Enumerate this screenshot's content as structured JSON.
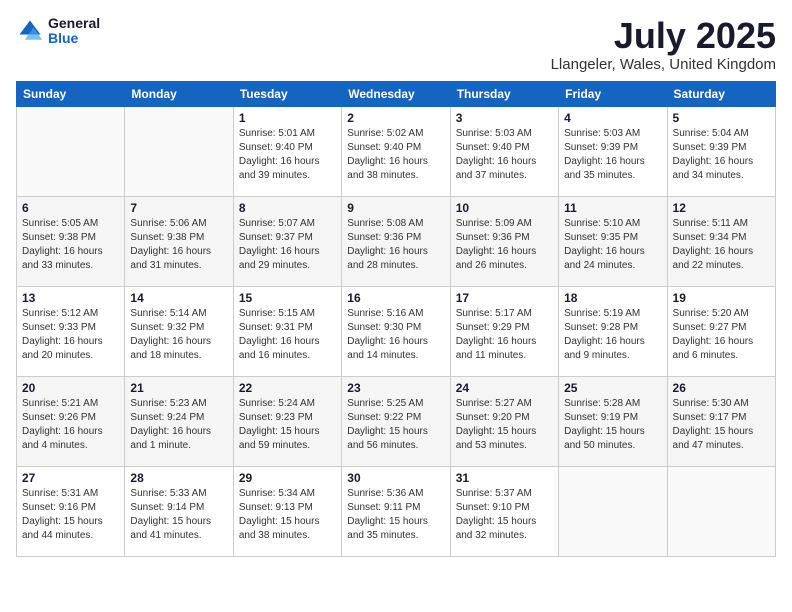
{
  "header": {
    "logo_general": "General",
    "logo_blue": "Blue",
    "month_year": "July 2025",
    "location": "Llangeler, Wales, United Kingdom"
  },
  "weekdays": [
    "Sunday",
    "Monday",
    "Tuesday",
    "Wednesday",
    "Thursday",
    "Friday",
    "Saturday"
  ],
  "weeks": [
    [
      {
        "day": "",
        "info": ""
      },
      {
        "day": "",
        "info": ""
      },
      {
        "day": "1",
        "info": "Sunrise: 5:01 AM\nSunset: 9:40 PM\nDaylight: 16 hours\nand 39 minutes."
      },
      {
        "day": "2",
        "info": "Sunrise: 5:02 AM\nSunset: 9:40 PM\nDaylight: 16 hours\nand 38 minutes."
      },
      {
        "day": "3",
        "info": "Sunrise: 5:03 AM\nSunset: 9:40 PM\nDaylight: 16 hours\nand 37 minutes."
      },
      {
        "day": "4",
        "info": "Sunrise: 5:03 AM\nSunset: 9:39 PM\nDaylight: 16 hours\nand 35 minutes."
      },
      {
        "day": "5",
        "info": "Sunrise: 5:04 AM\nSunset: 9:39 PM\nDaylight: 16 hours\nand 34 minutes."
      }
    ],
    [
      {
        "day": "6",
        "info": "Sunrise: 5:05 AM\nSunset: 9:38 PM\nDaylight: 16 hours\nand 33 minutes."
      },
      {
        "day": "7",
        "info": "Sunrise: 5:06 AM\nSunset: 9:38 PM\nDaylight: 16 hours\nand 31 minutes."
      },
      {
        "day": "8",
        "info": "Sunrise: 5:07 AM\nSunset: 9:37 PM\nDaylight: 16 hours\nand 29 minutes."
      },
      {
        "day": "9",
        "info": "Sunrise: 5:08 AM\nSunset: 9:36 PM\nDaylight: 16 hours\nand 28 minutes."
      },
      {
        "day": "10",
        "info": "Sunrise: 5:09 AM\nSunset: 9:36 PM\nDaylight: 16 hours\nand 26 minutes."
      },
      {
        "day": "11",
        "info": "Sunrise: 5:10 AM\nSunset: 9:35 PM\nDaylight: 16 hours\nand 24 minutes."
      },
      {
        "day": "12",
        "info": "Sunrise: 5:11 AM\nSunset: 9:34 PM\nDaylight: 16 hours\nand 22 minutes."
      }
    ],
    [
      {
        "day": "13",
        "info": "Sunrise: 5:12 AM\nSunset: 9:33 PM\nDaylight: 16 hours\nand 20 minutes."
      },
      {
        "day": "14",
        "info": "Sunrise: 5:14 AM\nSunset: 9:32 PM\nDaylight: 16 hours\nand 18 minutes."
      },
      {
        "day": "15",
        "info": "Sunrise: 5:15 AM\nSunset: 9:31 PM\nDaylight: 16 hours\nand 16 minutes."
      },
      {
        "day": "16",
        "info": "Sunrise: 5:16 AM\nSunset: 9:30 PM\nDaylight: 16 hours\nand 14 minutes."
      },
      {
        "day": "17",
        "info": "Sunrise: 5:17 AM\nSunset: 9:29 PM\nDaylight: 16 hours\nand 11 minutes."
      },
      {
        "day": "18",
        "info": "Sunrise: 5:19 AM\nSunset: 9:28 PM\nDaylight: 16 hours\nand 9 minutes."
      },
      {
        "day": "19",
        "info": "Sunrise: 5:20 AM\nSunset: 9:27 PM\nDaylight: 16 hours\nand 6 minutes."
      }
    ],
    [
      {
        "day": "20",
        "info": "Sunrise: 5:21 AM\nSunset: 9:26 PM\nDaylight: 16 hours\nand 4 minutes."
      },
      {
        "day": "21",
        "info": "Sunrise: 5:23 AM\nSunset: 9:24 PM\nDaylight: 16 hours\nand 1 minute."
      },
      {
        "day": "22",
        "info": "Sunrise: 5:24 AM\nSunset: 9:23 PM\nDaylight: 15 hours\nand 59 minutes."
      },
      {
        "day": "23",
        "info": "Sunrise: 5:25 AM\nSunset: 9:22 PM\nDaylight: 15 hours\nand 56 minutes."
      },
      {
        "day": "24",
        "info": "Sunrise: 5:27 AM\nSunset: 9:20 PM\nDaylight: 15 hours\nand 53 minutes."
      },
      {
        "day": "25",
        "info": "Sunrise: 5:28 AM\nSunset: 9:19 PM\nDaylight: 15 hours\nand 50 minutes."
      },
      {
        "day": "26",
        "info": "Sunrise: 5:30 AM\nSunset: 9:17 PM\nDaylight: 15 hours\nand 47 minutes."
      }
    ],
    [
      {
        "day": "27",
        "info": "Sunrise: 5:31 AM\nSunset: 9:16 PM\nDaylight: 15 hours\nand 44 minutes."
      },
      {
        "day": "28",
        "info": "Sunrise: 5:33 AM\nSunset: 9:14 PM\nDaylight: 15 hours\nand 41 minutes."
      },
      {
        "day": "29",
        "info": "Sunrise: 5:34 AM\nSunset: 9:13 PM\nDaylight: 15 hours\nand 38 minutes."
      },
      {
        "day": "30",
        "info": "Sunrise: 5:36 AM\nSunset: 9:11 PM\nDaylight: 15 hours\nand 35 minutes."
      },
      {
        "day": "31",
        "info": "Sunrise: 5:37 AM\nSunset: 9:10 PM\nDaylight: 15 hours\nand 32 minutes."
      },
      {
        "day": "",
        "info": ""
      },
      {
        "day": "",
        "info": ""
      }
    ]
  ]
}
